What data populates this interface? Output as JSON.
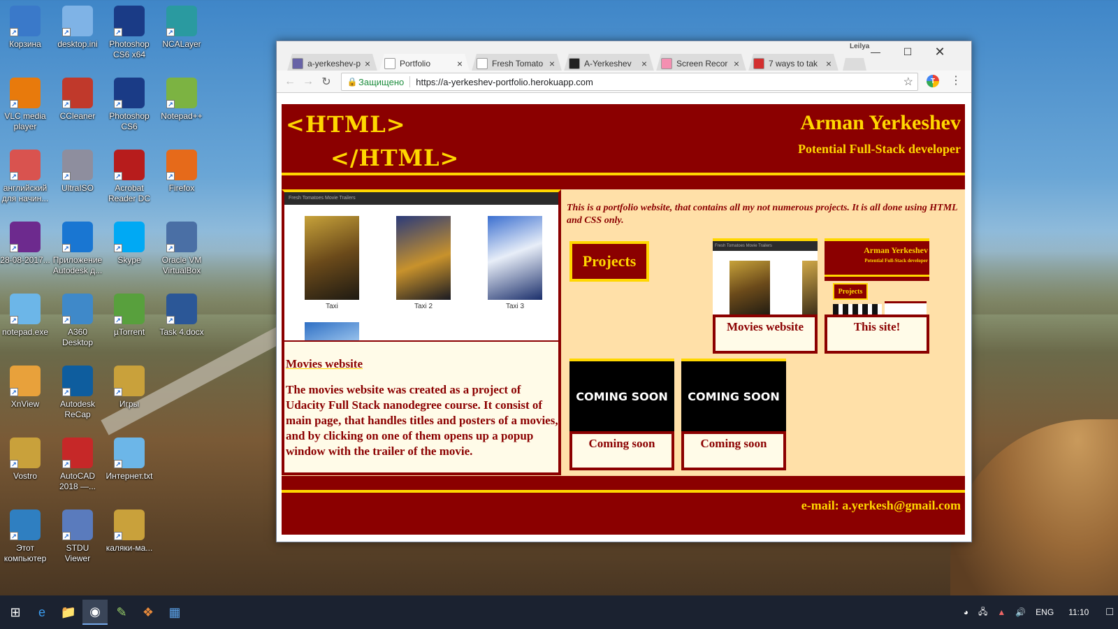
{
  "desktop": {
    "icons": [
      {
        "label": "Корзина",
        "icon": "recycle-bin-icon"
      },
      {
        "label": "desktop.ini",
        "icon": "settings-file-icon"
      },
      {
        "label": "Photoshop CS6 x64",
        "icon": "photoshop-icon"
      },
      {
        "label": "NCALayer",
        "icon": "ncalayer-icon"
      },
      {
        "label": "VLC media player",
        "icon": "vlc-icon"
      },
      {
        "label": "CCleaner",
        "icon": "ccleaner-icon"
      },
      {
        "label": "Photoshop CS6",
        "icon": "photoshop-icon"
      },
      {
        "label": "Notepad++",
        "icon": "notepadpp-icon"
      },
      {
        "label": "английский для начин...",
        "icon": "pdf-icon"
      },
      {
        "label": "UltraISO",
        "icon": "disc-icon"
      },
      {
        "label": "Acrobat Reader DC",
        "icon": "acrobat-icon"
      },
      {
        "label": "Firefox",
        "icon": "firefox-icon"
      },
      {
        "label": "28-08-2017...",
        "icon": "winrar-icon"
      },
      {
        "label": "Приложение Autodesk д...",
        "icon": "autodesk-icon"
      },
      {
        "label": "Skype",
        "icon": "skype-icon"
      },
      {
        "label": "Oracle VM VirtualBox",
        "icon": "virtualbox-icon"
      },
      {
        "label": "notepad.exe",
        "icon": "notepad-icon"
      },
      {
        "label": "A360 Desktop",
        "icon": "a360-icon"
      },
      {
        "label": "µTorrent",
        "icon": "utorrent-icon"
      },
      {
        "label": "Task 4.docx",
        "icon": "word-doc-icon"
      },
      {
        "label": "XnView",
        "icon": "xnview-icon"
      },
      {
        "label": "Autodesk ReCap",
        "icon": "recap-icon"
      },
      {
        "label": "Игры",
        "icon": "folder-icon"
      },
      {
        "label": "Vostro",
        "icon": "user-folder-icon"
      },
      {
        "label": "AutoCAD 2018 —...",
        "icon": "autocad-icon"
      },
      {
        "label": "Интернет.txt",
        "icon": "text-file-icon"
      },
      {
        "label": "Этот компьютер",
        "icon": "computer-icon"
      },
      {
        "label": "STDU Viewer",
        "icon": "stdu-icon"
      },
      {
        "label": "каляки-ма...",
        "icon": "folder-icon"
      }
    ]
  },
  "browser": {
    "profile": "Leilya",
    "tabs": [
      {
        "title": "a-yerkeshev-p",
        "favicon": "heroku-icon",
        "color": "#6762a6"
      },
      {
        "title": "Portfolio",
        "favicon": "page-icon",
        "color": "#ffffff"
      },
      {
        "title": "Fresh Tomato",
        "favicon": "page-icon",
        "color": "#ffffff"
      },
      {
        "title": "A-Yerkeshev",
        "favicon": "github-icon",
        "color": "#222222"
      },
      {
        "title": "Screen Recor",
        "favicon": "screen-recorder-icon",
        "color": "#f48fb1"
      },
      {
        "title": "7 ways to tak",
        "favicon": "article-icon",
        "color": "#d32f2f"
      }
    ],
    "secure_label": "Защищено",
    "url": "https://a-yerkeshev-portfolio.herokuapp.com"
  },
  "page": {
    "logo_line1": "<HTML>",
    "logo_line2": "</HTML>",
    "name": "Arman Yerkeshev",
    "role": "Potential Full-Stack developer",
    "intro": "This is a portfolio website, that contains all my not numerous projects. It is all done using HTML and CSS only.",
    "projects_button": "Projects",
    "featured": {
      "screenshot_header": "Fresh Tomatoes Movie Trailers",
      "posters": [
        "Taxi",
        "Taxi 2",
        "Taxi 3"
      ],
      "title": "Movies website",
      "description": "The movies website was created as a project of Udacity Full Stack nanodegree course. It consist of main page, that handles titles and posters of a movies, and by clicking on one of them opens up a popup window with the trailer of the movie."
    },
    "cards": [
      {
        "caption": "Movies website",
        "thumb_header": "Fresh Tomatoes Movie Trailers"
      },
      {
        "caption": "This site!",
        "thumb_name": "Arman Yerkeshev",
        "thumb_role": "Potential Full-Stack developer",
        "thumb_button": "Projects"
      },
      {
        "caption": "Coming soon",
        "thumb_text": "COMING SOON"
      },
      {
        "caption": "Coming soon",
        "thumb_text": "COMING SOON"
      }
    ],
    "email": "e-mail: a.yerkesh@gmail.com",
    "colors": {
      "primary": "#8b0000",
      "accent": "#ffd700",
      "background": "#ffe0a8"
    }
  },
  "taskbar": {
    "language": "ENG",
    "time": "11:10"
  }
}
